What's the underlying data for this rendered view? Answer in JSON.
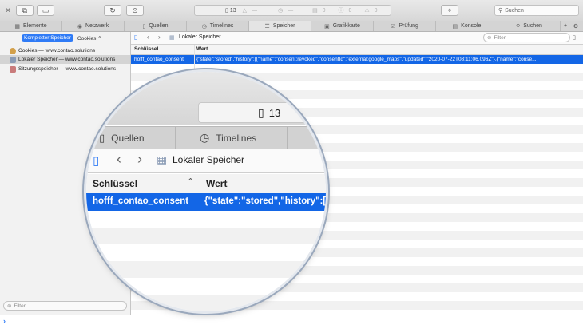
{
  "toolbar": {
    "close_glyph": "×",
    "activity_count": "13",
    "activity_rest": [
      {
        "icon": "△",
        "value": "—"
      },
      {
        "icon": "◷",
        "value": "—"
      },
      {
        "icon": "▤",
        "value": "0"
      },
      {
        "icon": "ⓘ",
        "value": "0"
      },
      {
        "icon": "⚠",
        "value": "0"
      }
    ],
    "search_placeholder": "Suchen"
  },
  "tabs": [
    {
      "label": "Elemente",
      "icon": "element-tab-icon"
    },
    {
      "label": "Netzwerk",
      "icon": "network-tab-icon"
    },
    {
      "label": "Quellen",
      "icon": "sources-tab-icon"
    },
    {
      "label": "Timelines",
      "icon": "timelines-tab-icon"
    },
    {
      "label": "Speicher",
      "icon": "storage-tab-icon",
      "active": true
    },
    {
      "label": "Grafikkarte",
      "icon": "graphics-tab-icon"
    },
    {
      "label": "Prüfung",
      "icon": "audit-tab-icon"
    },
    {
      "label": "Konsole",
      "icon": "console-tab-icon"
    },
    {
      "label": "Suchen",
      "icon": "search-tab-icon"
    }
  ],
  "sidebar": {
    "segment_active": "Kompletter Speicher",
    "segment_other": "Cookies ⌃",
    "items": [
      {
        "label": "Cookies — www.contao.solutions",
        "color": "#d3a04a"
      },
      {
        "label": "Lokaler Speicher — www.contao.solutions",
        "color": "#8a9bb5",
        "selected": true
      },
      {
        "label": "Sitzungsspeicher — www.contao.solutions",
        "color": "#c97b7b"
      }
    ],
    "filter_placeholder": "Filter"
  },
  "main": {
    "title": "Lokaler Speicher",
    "filter_placeholder": "Filter",
    "columns": {
      "key": "Schlüssel",
      "value": "Wert"
    },
    "rows": [
      {
        "key": "hofff_contao_consent",
        "value": "{\"state\":\"stored\",\"history\":[{\"name\":\"consent:revoked\",\"consentId\":\"external:google_maps\",\"updated\":\"2020-07-22T08:11:06.096Z\"},{\"name\":\"conse..."
      }
    ]
  },
  "magnifier": {
    "count": "13",
    "tabs": [
      "Quellen",
      "Timelines"
    ],
    "title": "Lokaler Speicher",
    "col_key": "Schlüssel",
    "col_value": "Wert",
    "row_key": "hofff_contao_consent",
    "row_value": "{\"state\":\"stored\",\"history\":["
  },
  "console": {
    "prompt": "›"
  },
  "colors": {
    "accent": "#2f7bf6",
    "selection": "#1366e6"
  }
}
